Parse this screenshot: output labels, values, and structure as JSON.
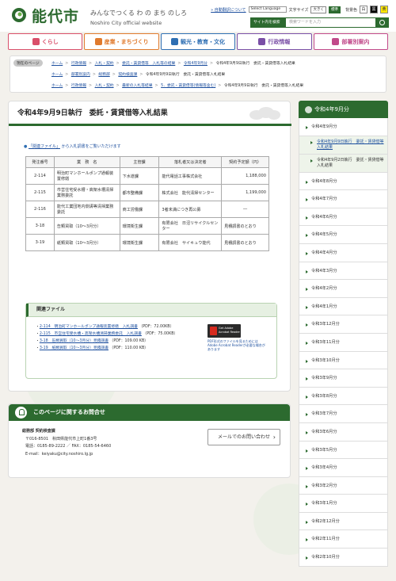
{
  "header": {
    "site_name": "能代市",
    "tagline": "みんなでつくる わ の まち のしろ",
    "subtitle": "Noshiro City official website",
    "links": {
      "auto_translate": "» 自動翻訳について",
      "language_select": "Select Language",
      "font_size_label": "文字サイズ",
      "size_large": "大きく",
      "size_standard": "標準",
      "bg_color_label": "背景色",
      "bg_white": "白",
      "bg_black": "黒",
      "bg_yellow": "黄"
    },
    "search": {
      "label": "サイト内を検索",
      "placeholder": "検索ワードを入力"
    }
  },
  "gnav": [
    {
      "label": "くらし",
      "color": "#d94f6a"
    },
    {
      "label": "産業・まちづくり",
      "color": "#e07b2e"
    },
    {
      "label": "観光・教育・文化",
      "color": "#2f6fb3"
    },
    {
      "label": "行政情報",
      "color": "#7a4fa6"
    },
    {
      "label": "部署別案内",
      "color": "#c14a8a"
    }
  ],
  "breadcrumbs": {
    "tag": "現在のページ",
    "line1": [
      "ホーム",
      "行政情報",
      "入札・契約",
      "委託・賃貸借等　入札等の結果",
      "令和4年9月分",
      "令和4年9月9日執行　委託・賃貸借等入札結果"
    ],
    "line2": [
      "ホーム",
      "部署別案内",
      "総務部",
      "契約検査課",
      "令和4年9月9日執行　委託・賃貸借等入札結果"
    ],
    "line3": [
      "ホーム",
      "行政情報",
      "入札・契約",
      "最新の入札等結果",
      "5．委託・賃貸借等(情報等含む)",
      "令和4年9月9日執行　委託・賃貸借等入札結果"
    ]
  },
  "main": {
    "title": "令和4年9月9日執行　委託・賃貸借等入札結果",
    "related_prefix": "「関連ファイル」",
    "related_text": "から入札調書をご覧いただけます",
    "table": {
      "headers": [
        "発注番号",
        "業　務　名",
        "主管課",
        "落札者又は決定者",
        "契約予定額（円）"
      ],
      "rows": [
        [
          "2-114",
          "明治町マンホールポンプ通報装置修繕",
          "下水道課",
          "能代電話工事株式会社",
          "1,188,000"
        ],
        [
          "2-115",
          "市営住宅受水槽・高架水槽清掃業務委託",
          "都市整備課",
          "株式会社　能代清掃センター",
          "1,199,000"
        ],
        [
          "2-116",
          "能代工業団地内側溝等清掃業務委託",
          "商工労働課",
          "3者未満につき再公募",
          "―"
        ],
        [
          "3-18",
          "缶類買取（10～3月分）",
          "環境衛生課",
          "有限会社　日沼リサイクルセンター",
          "見積調書のとおり"
        ],
        [
          "3-19",
          "紙類買取（10～3月分）",
          "環境衛生課",
          "有限会社　サイキュウ能代",
          "見積調書のとおり"
        ]
      ]
    },
    "files": {
      "heading": "関連ファイル",
      "items": [
        {
          "link": "2-114　明治町マンホールポンプ通報装置修繕　入札調書",
          "meta": "（PDF：72.00KB）"
        },
        {
          "link": "2-115　市営住宅受水槽・高架水槽清掃業務委託　入札調書",
          "meta": "（PDF：75.00KB）"
        },
        {
          "link": "3-18　缶類買取（10～3月分）見積調書",
          "meta": "（PDF：109.00 KB）"
        },
        {
          "link": "3-19　紙類買取（10～3月分）見積調書",
          "meta": "（PDF：110.00 KB）"
        }
      ],
      "reader_badge_1": "Get Adobe",
      "reader_badge_2": "Acrobat Reader",
      "reader_note": "PDF形式のファイルを見るためにはAdobe Acrobat Readerが必要な場合があります"
    }
  },
  "contact": {
    "heading": "このページに関するお問合せ",
    "dept": "総務部 契約検査課",
    "address": "〒016-8501　秋田県能代市上町1番3号",
    "phone": "電話：0185-89-2222 ／ FAX：0185-54-6460",
    "email": "E-mail：keiyaku@city.noshiro.lg.jp",
    "form_button": "メールでのお問い合わせ"
  },
  "sidebar": {
    "heading": "令和4年9月分",
    "top_item": "令和4年9月分",
    "sub_items": [
      "令和4年9月9日執行　委託・賃貸借等入札結果",
      "令和4年9月2日執行　委託・賃貸借等入札結果"
    ],
    "items": [
      "令和4年8月分",
      "令和4年7月分",
      "令和4年6月分",
      "令和4年5月分",
      "令和4年4月分",
      "令和4年3月分",
      "令和4年2月分",
      "令和4年1月分",
      "令和3年12月分",
      "令和3年11月分",
      "令和3年10月分",
      "令和3年9月分",
      "令和3年8月分",
      "令和3年7月分",
      "令和3年6月分",
      "令和3年5月分",
      "令和3年4月分",
      "令和3年2月分",
      "令和3年1月分",
      "令和2年12月分",
      "令和2年11月分",
      "令和2年10月分"
    ]
  }
}
